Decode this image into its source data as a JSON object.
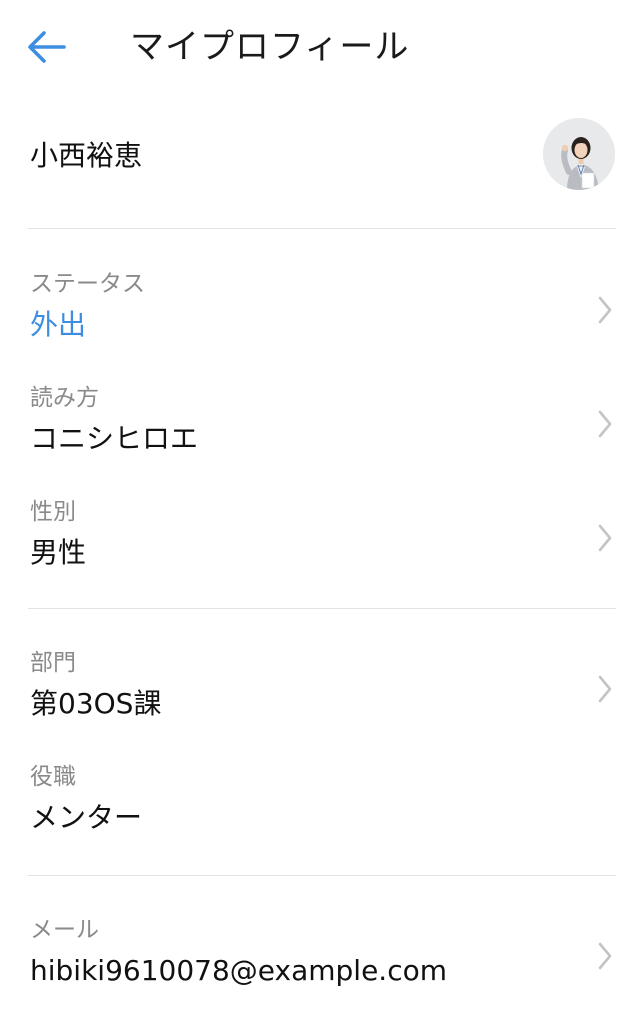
{
  "header": {
    "back_icon": "arrow-left-icon",
    "title": "マイプロフィール"
  },
  "profile": {
    "name": "小西裕恵",
    "avatar_icon": "user-photo"
  },
  "fields": [
    {
      "label": "ステータス",
      "value": "外出",
      "chevron": true
    },
    {
      "label": "読み方",
      "value": "コニシヒロエ",
      "chevron": true
    },
    {
      "label": "性別",
      "value": "男性",
      "chevron": true
    },
    {
      "label": "部門",
      "value": "第03OS課",
      "chevron": true
    },
    {
      "label": "役職",
      "value": "メンター",
      "chevron": false
    },
    {
      "label": "メール",
      "value": "hibiki9610078@example.com",
      "chevron": true
    }
  ],
  "colors": {
    "accent": "#3d8ee0",
    "label": "#8a8a8a",
    "divider": "#e3e3e3",
    "chevron": "#c4c4c4"
  }
}
